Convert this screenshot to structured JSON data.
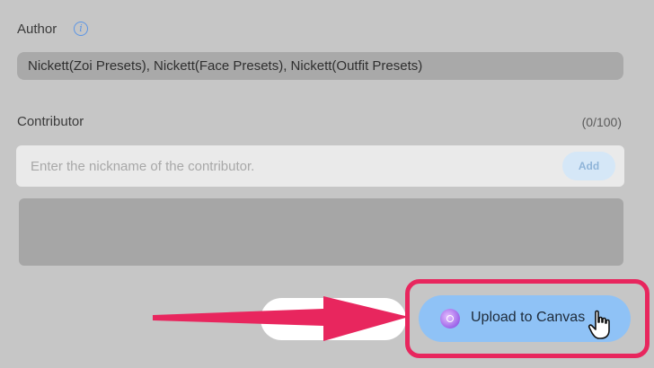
{
  "author": {
    "label": "Author",
    "info_icon": "i",
    "value": "Nickett(Zoi Presets), Nickett(Face Presets), Nickett(Outfit Presets)"
  },
  "contributor": {
    "label": "Contributor",
    "count": "(0/100)",
    "placeholder": "Enter the nickname of the contributor.",
    "add_label": "Add"
  },
  "upload": {
    "label": "Upload to Canvas",
    "icon": "canvas-icon"
  },
  "annotation": {
    "arrow_color": "#e8265e",
    "highlight_color": "#e8265e"
  },
  "colors": {
    "background": "#c6c6c6",
    "upload_button": "#8fc2f6",
    "info_blue": "#5b95e6"
  }
}
